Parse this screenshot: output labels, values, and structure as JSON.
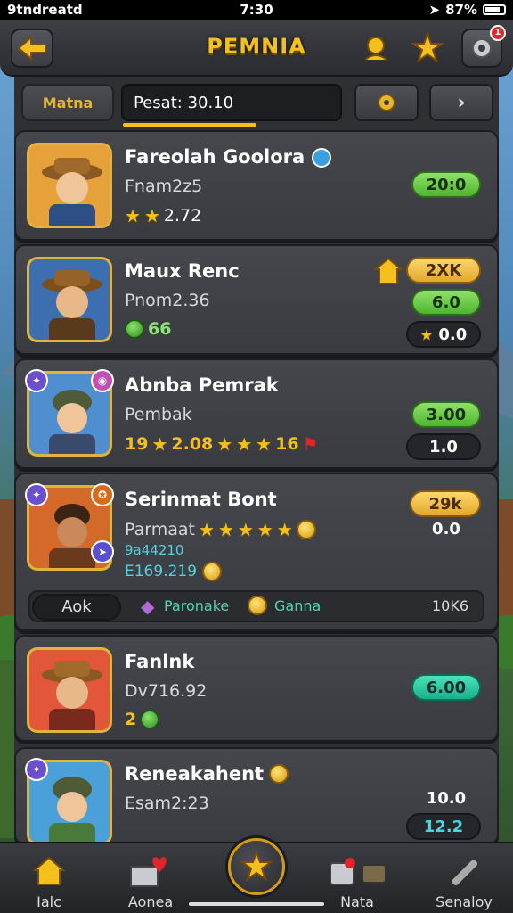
{
  "status_bar": {
    "carrier": "9tndreatd",
    "time": "7:30",
    "battery": "87%"
  },
  "header": {
    "title": "PEMNIA",
    "notification_count": "1"
  },
  "filter_bar": {
    "tab_label": "Matna",
    "search_value": "Pesat: 30.10"
  },
  "cards": [
    {
      "name": "Fareolah Goolora",
      "sub": "Fnam2z5",
      "rating": "2.72",
      "stars": 2,
      "pill_primary": "20:0",
      "theme": "#e6a13a"
    },
    {
      "name": "Maux Renc",
      "sub": "Pnom2.36",
      "currency": "66",
      "pill_badge": "2XK",
      "pill_primary": "6.0",
      "pill_secondary": "0.0",
      "theme": "#3d6fb0"
    },
    {
      "name": "Abnba Pemrak",
      "sub": "Pembak",
      "line3_left": "19",
      "line3_mid": "2.08",
      "line3_right": "16",
      "pill_primary": "3.00",
      "pill_secondary": "1.0",
      "theme": "#4f8fd0"
    },
    {
      "name": "Serinmat Bont",
      "sub": "Parmaat",
      "line3a": "9a44210",
      "line3b": "E169.219",
      "pill_badge": "29k",
      "pill_primary": "0.0",
      "button_label": "Aok",
      "tag1": "Paronake",
      "tag2": "Ganna",
      "tag_value": "10K6",
      "theme": "#d46a2a"
    },
    {
      "name": "Fanlnk",
      "sub": "Dv716.92",
      "currency": "2",
      "pill_primary": "6.00",
      "theme": "#e2573a"
    },
    {
      "name": "Reneakahent",
      "sub": "Esam2:23",
      "pill_primary": "10.0",
      "pill_secondary": "12.2",
      "theme": "#4aa0d8"
    }
  ],
  "bottom_nav": [
    {
      "label": "Ialc",
      "icon": "home-icon"
    },
    {
      "label": "Aonea",
      "icon": "inbox-icon"
    },
    {
      "label": "Nata",
      "icon": "chest-icon"
    },
    {
      "label": "Senaloy",
      "icon": "tools-icon"
    }
  ],
  "colors": {
    "accent": "#f4c01e",
    "panel": "#2f3034",
    "pill_green": "#4db52f",
    "pill_teal": "#18b08a"
  }
}
